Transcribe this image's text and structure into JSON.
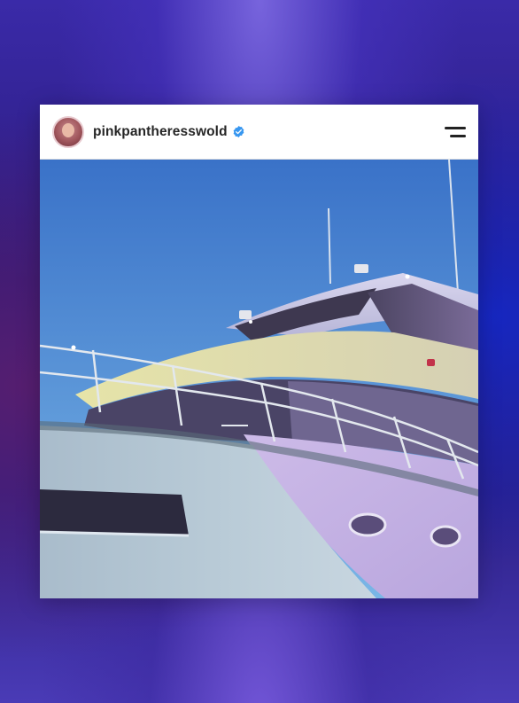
{
  "post": {
    "username": "pinkpantheresswold",
    "verified": true,
    "verified_icon": "verified-badge-icon",
    "menu_icon": "menu-icon",
    "image_subject": "yacht-illustration"
  },
  "colors": {
    "verified_blue": "#3897f0",
    "sky_top": "#3a72c8",
    "sky_bottom": "#79b6e6",
    "hull": "#b8c9d6",
    "accent_lavender": "#c6b3e6"
  }
}
